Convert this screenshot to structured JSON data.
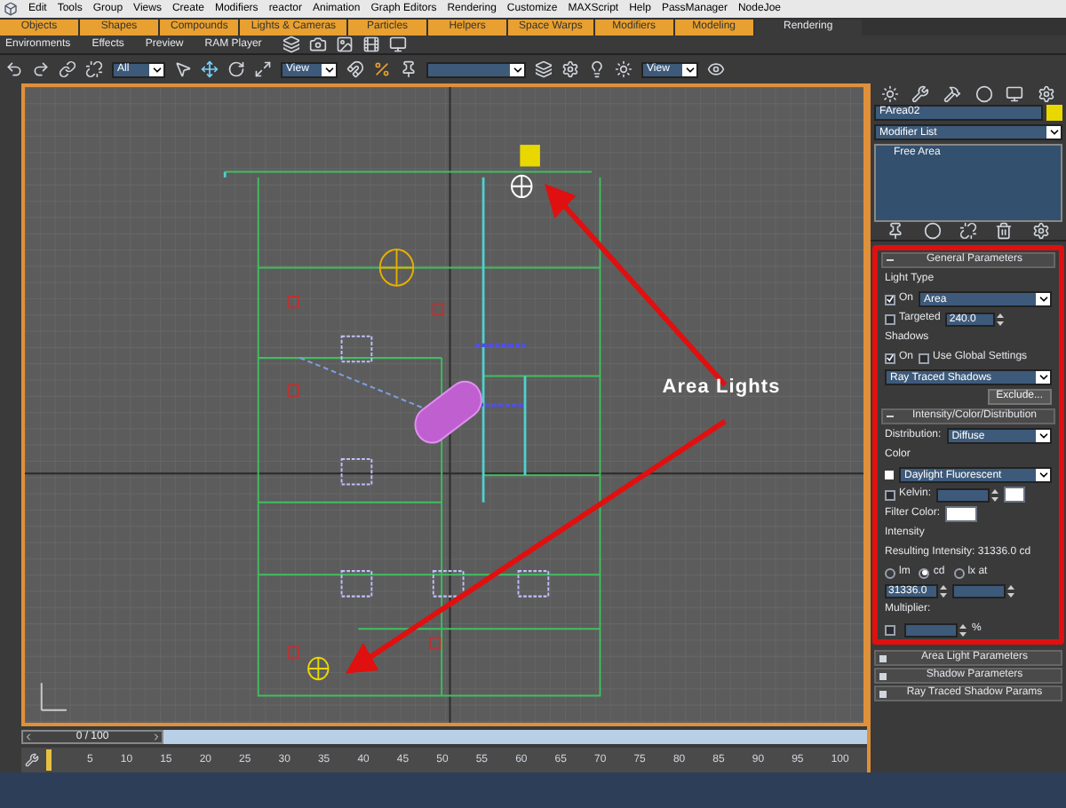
{
  "menu_bar": {
    "items": [
      "Edit",
      "Tools",
      "Group",
      "Views",
      "Create",
      "Modifiers",
      "reactor",
      "Animation",
      "Graph Editors",
      "Rendering",
      "Customize",
      "MAXScript",
      "Help",
      "PassManager",
      "NodeJoe"
    ]
  },
  "shelf_tabs": [
    {
      "label": "Objects",
      "selected": false
    },
    {
      "label": "Shapes",
      "selected": false
    },
    {
      "label": "Compounds",
      "selected": false
    },
    {
      "label": "Lights & Cameras",
      "selected": false
    },
    {
      "label": "Particles",
      "selected": false
    },
    {
      "label": "Helpers",
      "selected": false
    },
    {
      "label": "Space Warps",
      "selected": false
    },
    {
      "label": "Modifiers",
      "selected": false
    },
    {
      "label": "Modeling",
      "selected": false
    },
    {
      "label": "Rendering",
      "selected": true
    }
  ],
  "render_toolbar": {
    "items": [
      "Environments",
      "Effects",
      "Preview",
      "RAM Player"
    ]
  },
  "main_toolbar": {
    "selection_filter": "All",
    "reference_coordinate": "View",
    "view_dropdown": "View"
  },
  "viewport": {
    "annotation": "Area Lights"
  },
  "command_panel": {
    "object_name": "FArea02",
    "modifier_list": "Modifier List",
    "stack": [
      "Free Area"
    ],
    "rollouts": [
      {
        "kind": "general",
        "title": "General Parameters",
        "expanded": true,
        "light_type_label": "Light Type",
        "light_on": {
          "label": "On",
          "checked": true
        },
        "light_type": "Area",
        "targeted": {
          "label": "Targeted",
          "checked": false
        },
        "target_distance": "240.0",
        "shadows_label": "Shadows",
        "shadows_on": {
          "label": "On",
          "checked": true
        },
        "use_global": {
          "label": "Use Global Settings",
          "checked": false
        },
        "shadow_type": "Ray Traced Shadows",
        "exclude_button": "Exclude..."
      },
      {
        "kind": "intensity",
        "title": "Intensity/Color/Distribution",
        "expanded": true,
        "distribution_label": "Distribution:",
        "distribution": "Diffuse",
        "color_label": "Color",
        "color_preset": "Daylight Fluorescent",
        "kelvin": {
          "label": "Kelvin:",
          "checked": false
        },
        "filter_color_label": "Filter Color:",
        "intensity_label": "Intensity",
        "resulting_intensity": "Resulting Intensity: 31336.0 cd",
        "units": [
          {
            "label": "lm",
            "selected": false
          },
          {
            "label": "cd",
            "selected": true
          },
          {
            "label": "lx at",
            "selected": false
          }
        ],
        "intensity_value": "31336.0",
        "multiplier": {
          "label": "Multiplier:",
          "checked": false
        },
        "percent_label": "%"
      },
      {
        "kind": "header",
        "title": "Area Light Parameters",
        "expanded": false
      },
      {
        "kind": "header",
        "title": "Shadow Parameters",
        "expanded": false
      },
      {
        "kind": "header",
        "title": "Ray Traced Shadow Params",
        "expanded": false
      }
    ]
  },
  "time_slider": {
    "label": "0 / 100",
    "level": 0
  },
  "track_ticks": [
    "5",
    "10",
    "15",
    "20",
    "25",
    "30",
    "35",
    "40",
    "45",
    "50",
    "55",
    "60",
    "65",
    "70",
    "75",
    "80",
    "85",
    "90",
    "95",
    "100"
  ]
}
